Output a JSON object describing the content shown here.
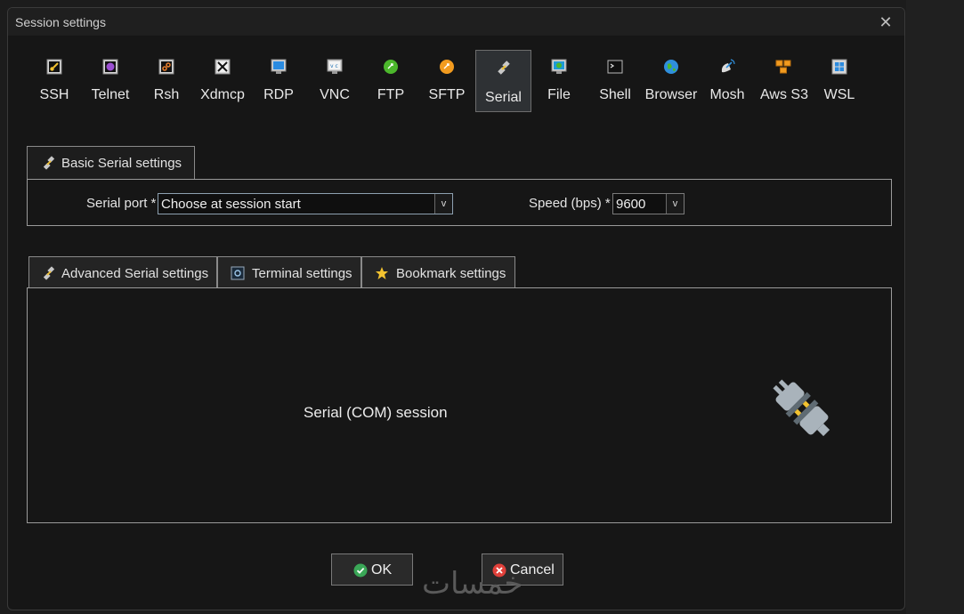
{
  "window": {
    "title": "Session settings",
    "close_glyph": "✕"
  },
  "protocols": [
    {
      "label": "SSH",
      "icon": "ssh-key-icon"
    },
    {
      "label": "Telnet",
      "icon": "telnet-icon"
    },
    {
      "label": "Rsh",
      "icon": "rsh-icon"
    },
    {
      "label": "Xdmcp",
      "icon": "xdmcp-icon"
    },
    {
      "label": "RDP",
      "icon": "rdp-icon"
    },
    {
      "label": "VNC",
      "icon": "vnc-icon"
    },
    {
      "label": "FTP",
      "icon": "ftp-icon"
    },
    {
      "label": "SFTP",
      "icon": "sftp-icon"
    },
    {
      "label": "Serial",
      "icon": "serial-plug-icon",
      "active": true
    },
    {
      "label": "File",
      "icon": "file-icon"
    },
    {
      "label": "Shell",
      "icon": "shell-icon"
    },
    {
      "label": "Browser",
      "icon": "browser-globe-icon"
    },
    {
      "label": "Mosh",
      "icon": "mosh-satellite-icon"
    },
    {
      "label": "Aws S3",
      "icon": "aws-s3-icon"
    },
    {
      "label": "WSL",
      "icon": "wsl-windows-icon"
    }
  ],
  "basic_tab": {
    "label": "Basic Serial settings"
  },
  "basic": {
    "serial_port_label": "Serial port *",
    "serial_port_value": "Choose at session start",
    "speed_label": "Speed (bps) *",
    "speed_value": "9600",
    "arrow_glyph": "v"
  },
  "lower_tabs": [
    {
      "label": "Advanced Serial settings",
      "icon": "serial-plug-icon"
    },
    {
      "label": "Terminal settings",
      "icon": "terminal-settings-icon"
    },
    {
      "label": "Bookmark settings",
      "icon": "star-icon"
    }
  ],
  "content": {
    "description": "Serial (COM) session"
  },
  "buttons": {
    "ok_label": "OK",
    "cancel_label": "Cancel"
  },
  "watermark": "خمسات",
  "colors": {
    "active_bg": "#2e3134",
    "ok_green": "#3aa757",
    "cancel_red": "#e0403a"
  }
}
